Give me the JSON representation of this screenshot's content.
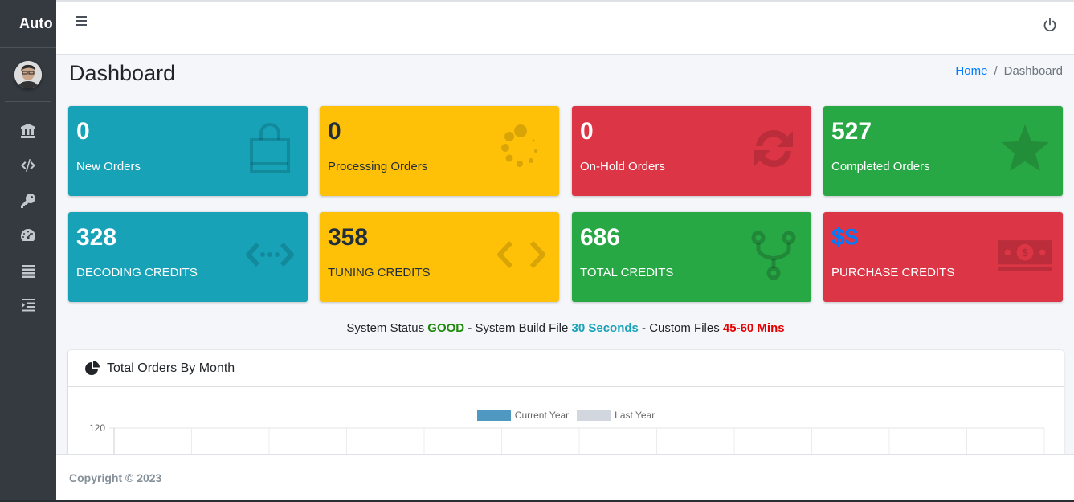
{
  "sidebar": {
    "brand": "Auto",
    "nav_icons": [
      "bank-icon",
      "code-icon",
      "key-icon",
      "dashboard-gauge-icon",
      "list-icon",
      "indent-icon"
    ]
  },
  "topbar": {
    "menu_icon": "hamburger-icon",
    "power_icon": "power-icon"
  },
  "header": {
    "title": "Dashboard",
    "breadcrumb": {
      "home": "Home",
      "separator": "/",
      "current": "Dashboard"
    }
  },
  "boxes": [
    {
      "value": "0",
      "label": "New Orders",
      "color": "#17a2b8",
      "icon": "shopping-bag-icon"
    },
    {
      "value": "0",
      "label": "Processing Orders",
      "color": "#ffc107",
      "icon": "spinner-icon"
    },
    {
      "value": "0",
      "label": "On-Hold Orders",
      "color": "#dc3545",
      "icon": "sync-icon"
    },
    {
      "value": "527",
      "label": "Completed Orders",
      "color": "#28a745",
      "icon": "star-icon"
    },
    {
      "value": "328",
      "label": "DECODING CREDITS",
      "color": "#17a2b8",
      "icon": "code-dots-icon"
    },
    {
      "value": "358",
      "label": "TUNING CREDITS",
      "color": "#ffc107",
      "icon": "code-icon"
    },
    {
      "value": "686",
      "label": "TOTAL CREDITS",
      "color": "#28a745",
      "icon": "code-branch-icon"
    },
    {
      "value": "$$",
      "label": "PURCHASE CREDITS",
      "color": "#dc3545",
      "icon": "money-bill-icon",
      "value_color": "#007bff"
    }
  ],
  "status": {
    "prefix": "System Status ",
    "status_value": "GOOD",
    "mid1": " - System Build File ",
    "build_value": "30 Seconds",
    "mid2": " - Custom Files ",
    "custom_value": "45-60 Mins"
  },
  "card": {
    "title": "Total Orders By Month",
    "icon": "pie-chart-icon"
  },
  "chart_data": {
    "type": "bar",
    "series": [
      {
        "name": "Current Year",
        "values": []
      },
      {
        "name": "Last Year",
        "values": []
      }
    ],
    "colors": [
      "#3c8dbc",
      "#d2d6de"
    ],
    "yticks": [
      120
    ],
    "grid": true,
    "legend": "top"
  },
  "footer": {
    "copyright": "Copyright © 2023"
  }
}
